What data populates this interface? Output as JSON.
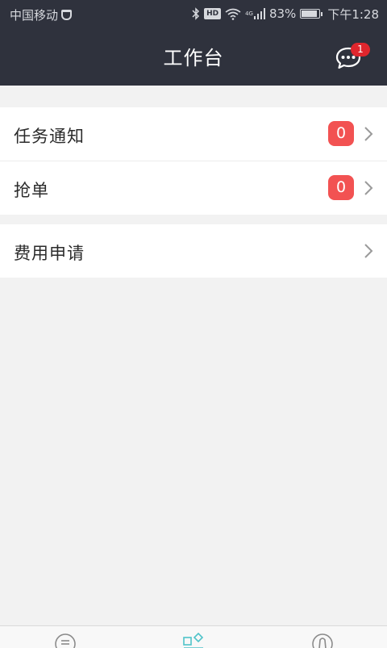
{
  "status_bar": {
    "carrier": "中国移动",
    "signal_label": "4G",
    "battery": "83%",
    "time": "下午1:28"
  },
  "header": {
    "title": "工作台",
    "message_badge": "1"
  },
  "menu": {
    "groups": [
      {
        "items": [
          {
            "label": "任务通知",
            "count": "0"
          },
          {
            "label": "抢单",
            "count": "0"
          }
        ]
      },
      {
        "items": [
          {
            "label": "费用申请"
          }
        ]
      }
    ]
  },
  "colors": {
    "header_bg": "#2f323d",
    "page_bg": "#f2f2f2",
    "badge_red": "#f25252",
    "accent": "#4fc3c9"
  },
  "tab_bar": {
    "icons": [
      "list-icon",
      "workbench-icon",
      "profile-icon"
    ],
    "active_index": 1
  }
}
